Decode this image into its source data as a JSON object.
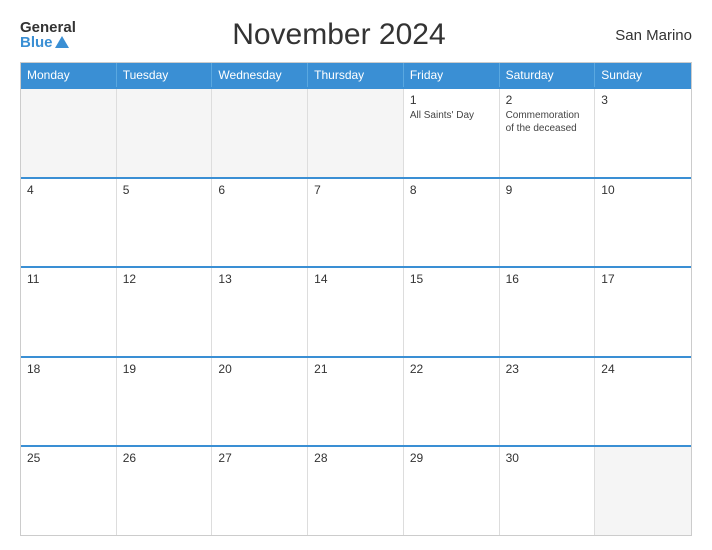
{
  "logo": {
    "general": "General",
    "blue": "Blue"
  },
  "title": "November 2024",
  "region": "San Marino",
  "header": {
    "days": [
      "Monday",
      "Tuesday",
      "Wednesday",
      "Thursday",
      "Friday",
      "Saturday",
      "Sunday"
    ]
  },
  "weeks": [
    {
      "cells": [
        {
          "day": "",
          "empty": true
        },
        {
          "day": "",
          "empty": true
        },
        {
          "day": "",
          "empty": true
        },
        {
          "day": "",
          "empty": true
        },
        {
          "day": "1",
          "event": "All Saints' Day"
        },
        {
          "day": "2",
          "event": "Commemoration of the deceased"
        },
        {
          "day": "3",
          "event": ""
        }
      ]
    },
    {
      "cells": [
        {
          "day": "4",
          "event": ""
        },
        {
          "day": "5",
          "event": ""
        },
        {
          "day": "6",
          "event": ""
        },
        {
          "day": "7",
          "event": ""
        },
        {
          "day": "8",
          "event": ""
        },
        {
          "day": "9",
          "event": ""
        },
        {
          "day": "10",
          "event": ""
        }
      ]
    },
    {
      "cells": [
        {
          "day": "11",
          "event": ""
        },
        {
          "day": "12",
          "event": ""
        },
        {
          "day": "13",
          "event": ""
        },
        {
          "day": "14",
          "event": ""
        },
        {
          "day": "15",
          "event": ""
        },
        {
          "day": "16",
          "event": ""
        },
        {
          "day": "17",
          "event": ""
        }
      ]
    },
    {
      "cells": [
        {
          "day": "18",
          "event": ""
        },
        {
          "day": "19",
          "event": ""
        },
        {
          "day": "20",
          "event": ""
        },
        {
          "day": "21",
          "event": ""
        },
        {
          "day": "22",
          "event": ""
        },
        {
          "day": "23",
          "event": ""
        },
        {
          "day": "24",
          "event": ""
        }
      ]
    },
    {
      "cells": [
        {
          "day": "25",
          "event": ""
        },
        {
          "day": "26",
          "event": ""
        },
        {
          "day": "27",
          "event": ""
        },
        {
          "day": "28",
          "event": ""
        },
        {
          "day": "29",
          "event": ""
        },
        {
          "day": "30",
          "event": ""
        },
        {
          "day": "",
          "empty": true
        }
      ]
    }
  ]
}
